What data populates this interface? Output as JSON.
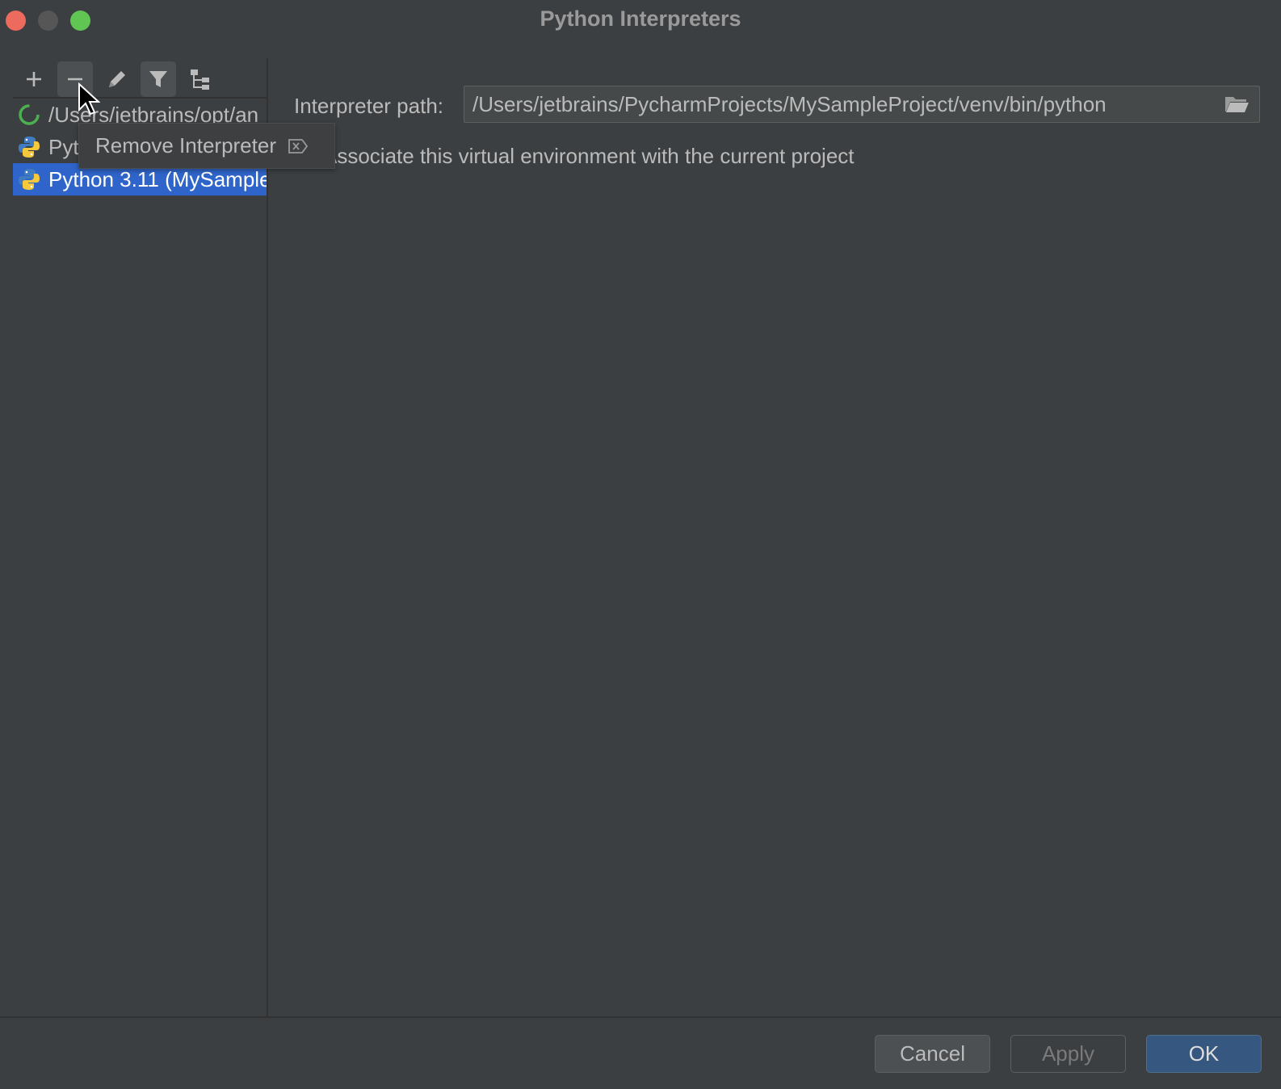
{
  "window": {
    "title": "Python Interpreters"
  },
  "toolbar": {
    "buttons": [
      {
        "icon": "plus-icon",
        "label": "Add"
      },
      {
        "icon": "minus-icon",
        "label": "Remove"
      },
      {
        "icon": "pencil-icon",
        "label": "Edit"
      },
      {
        "icon": "filter-icon",
        "label": "Filter"
      },
      {
        "icon": "tree-icon",
        "label": "Show paths"
      }
    ]
  },
  "interpreters": [
    {
      "label": "/Users/jetbrains/opt/an",
      "icon": "loading-icon",
      "selected": false
    },
    {
      "label": "Pyt",
      "icon": "python-icon",
      "selected": false
    },
    {
      "label": "Python 3.11 (MySample",
      "icon": "python-icon",
      "selected": true
    }
  ],
  "tooltip": {
    "text": "Remove Interpreter",
    "shortcut_icon": "delete-key-icon"
  },
  "details": {
    "path_label": "Interpreter path:",
    "path_value": "/Users/jetbrains/PycharmProjects/MySampleProject/venv/bin/python",
    "associate_label": "Associate this virtual environment with the current project",
    "associate_checked": false
  },
  "buttons": {
    "cancel": "Cancel",
    "apply": "Apply",
    "ok": "OK"
  },
  "colors": {
    "background": "#3c3f41",
    "selection": "#2f65ca",
    "ok_button": "#365880"
  }
}
